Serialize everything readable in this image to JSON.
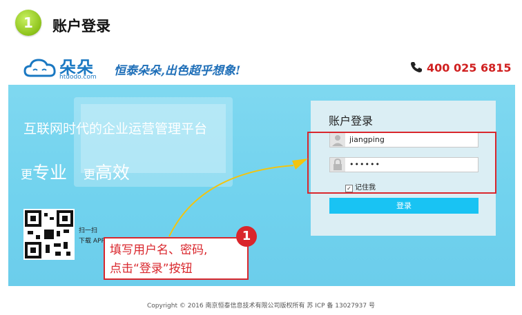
{
  "step": {
    "number": "1",
    "title": "账户登录"
  },
  "brand": {
    "name": "朵朵",
    "url": "htdodo.com",
    "slogan": "恒泰朵朵,出色超乎想象!",
    "phone": "400 025 6815"
  },
  "hero": {
    "headline": "互联网时代的企业运营管理平台",
    "tag1_prefix": "更",
    "tag1": "专业",
    "tag2_prefix": "更",
    "tag2": "高效",
    "qr_line1": "扫一扫",
    "qr_line2": "下载 APP"
  },
  "login": {
    "title": "账户登录",
    "username": "jiangping",
    "password": "••••••",
    "remember_label": "记住我",
    "remember_checked": true,
    "submit_label": "登录"
  },
  "annotation": {
    "number": "1",
    "line1": "填写用户名、密码,",
    "line2": "点击“登录”按钮"
  },
  "footer": {
    "text": "Copyright © 2016 南京恒泰信息技术有限公司版权所有 苏 ICP 备 13027937 号"
  },
  "colors": {
    "accent": "#19c3f3",
    "highlight": "#d9262c",
    "brand": "#1a78c2",
    "hero": "#74d4ee"
  }
}
